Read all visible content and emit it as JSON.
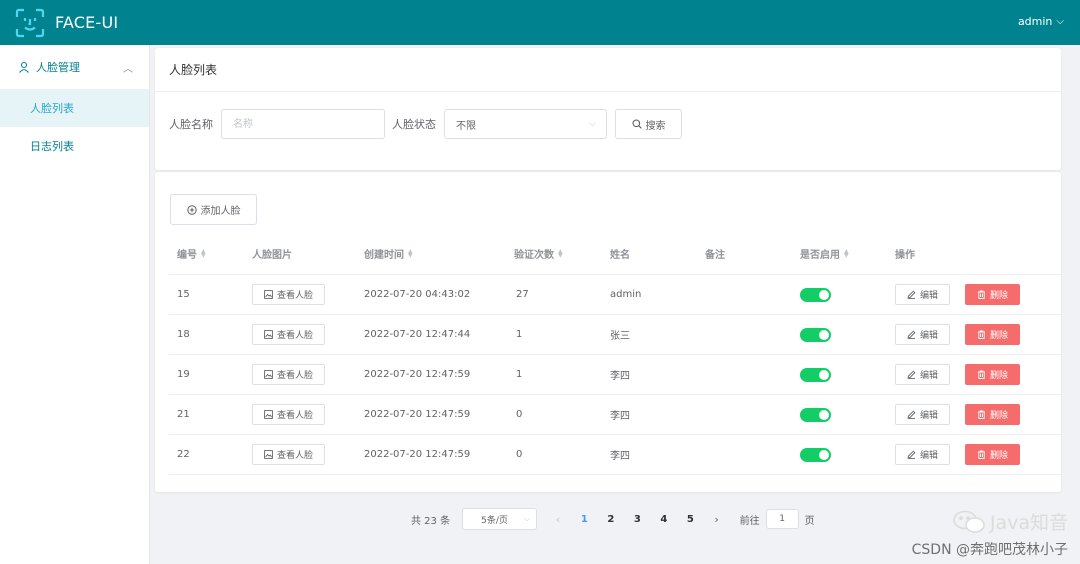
{
  "header": {
    "logo_text": "FACE-UI",
    "user": "admin"
  },
  "sidebar": {
    "group_label": "人脸管理",
    "items": [
      {
        "label": "人脸列表",
        "active": true
      },
      {
        "label": "日志列表",
        "active": false
      }
    ]
  },
  "filter": {
    "title": "人脸列表",
    "name_label": "人脸名称",
    "name_placeholder": "名称",
    "status_label": "人脸状态",
    "status_value": "不限",
    "search_label": "搜索"
  },
  "toolbar": {
    "add_label": "添加人脸"
  },
  "table": {
    "columns": [
      "编号",
      "人脸图片",
      "创建时间",
      "验证次数",
      "姓名",
      "备注",
      "是否启用",
      "操作"
    ],
    "view_label": "查看人脸",
    "edit_label": "编辑",
    "delete_label": "删除",
    "rows": [
      {
        "id": "15",
        "created": "2022-07-20 04:43:02",
        "count": "27",
        "name": "admin",
        "remark": "",
        "enabled": true
      },
      {
        "id": "18",
        "created": "2022-07-20 12:47:44",
        "count": "1",
        "name": "张三",
        "remark": "",
        "enabled": true
      },
      {
        "id": "19",
        "created": "2022-07-20 12:47:59",
        "count": "1",
        "name": "李四",
        "remark": "",
        "enabled": true
      },
      {
        "id": "21",
        "created": "2022-07-20 12:47:59",
        "count": "0",
        "name": "李四",
        "remark": "",
        "enabled": true
      },
      {
        "id": "22",
        "created": "2022-07-20 12:47:59",
        "count": "0",
        "name": "李四",
        "remark": "",
        "enabled": true
      }
    ]
  },
  "pagination": {
    "total_text": "共 23 条",
    "page_size": "5条/页",
    "pages": [
      "1",
      "2",
      "3",
      "4",
      "5"
    ],
    "current_page": "1",
    "goto_prefix": "前往",
    "goto_value": "1",
    "goto_suffix": "页"
  },
  "watermark": {
    "line1": "Java知音",
    "line2": "CSDN @奔跑吧茂林小子"
  },
  "colors": {
    "header": "#00838f",
    "primary": "#409eff",
    "switch_on": "#13ce66",
    "danger": "#f56c6c"
  }
}
